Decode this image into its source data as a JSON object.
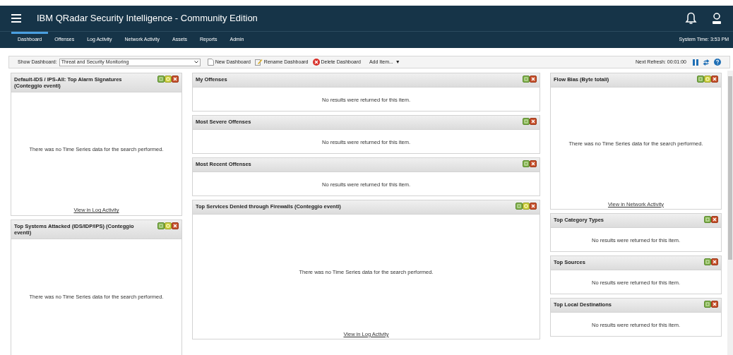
{
  "header": {
    "title": "IBM QRadar Security Intelligence - Community Edition"
  },
  "tabs": [
    {
      "label": "Dashboard",
      "selected": true
    },
    {
      "label": "Offenses",
      "selected": false
    },
    {
      "label": "Log Activity",
      "selected": false
    },
    {
      "label": "Network Activity",
      "selected": false
    },
    {
      "label": "Assets",
      "selected": false
    },
    {
      "label": "Reports",
      "selected": false
    },
    {
      "label": "Admin",
      "selected": false
    }
  ],
  "system_time": "System Time: 3:53 PM",
  "toolbar": {
    "show_label": "Show Dashboard:",
    "dashboard": "Threat and Security Monitoring",
    "buttons": [
      "New Dashboard",
      "Rename Dashboard",
      "Delete Dashboard"
    ],
    "add_item": "Add Item...",
    "add_caret": "▼",
    "next_refresh": "Next Refresh: 00:01:00"
  },
  "columns": [
    {
      "widgets": [
        {
          "kind": "chart",
          "title": "Default-IDS / IPS-All: Top Alarm Signatures (Conteggio eventi)",
          "settings": true,
          "message": "There was no Time Series data for the search performed.",
          "link": "View in Log Activity"
        },
        {
          "kind": "chart",
          "title": "Top Systems Attacked (IDS/IDP/IPS) (Conteggio eventi)",
          "settings": true,
          "message": "There was no Time Series data for the search performed."
        }
      ]
    },
    {
      "widgets": [
        {
          "kind": "list",
          "title": "My Offenses",
          "settings": false,
          "message": "No results were returned for this item."
        },
        {
          "kind": "list",
          "title": "Most Severe Offenses",
          "settings": false,
          "message": "No results were returned for this item."
        },
        {
          "kind": "list",
          "title": "Most Recent Offenses",
          "settings": false,
          "message": "No results were returned for this item."
        },
        {
          "kind": "chart",
          "title": "Top Services Denied through Firewalls (Conteggio eventi)",
          "settings": true,
          "message": "There was no Time Series data for the search performed.",
          "link": "View in Log Activity"
        }
      ]
    },
    {
      "widgets": [
        {
          "kind": "chart",
          "title": "Flow Bias (Byte totali)",
          "settings": true,
          "message": "There was no Time Series data for the search performed.",
          "link": "View in Network Activity"
        },
        {
          "kind": "list",
          "title": "Top Category Types",
          "settings": false,
          "message": "No results were returned for this item."
        },
        {
          "kind": "list",
          "title": "Top Sources",
          "settings": false,
          "message": "No results were returned for this item."
        },
        {
          "kind": "list",
          "title": "Top Local Destinations",
          "settings": false,
          "message": "No results were returned for this item."
        }
      ]
    }
  ]
}
